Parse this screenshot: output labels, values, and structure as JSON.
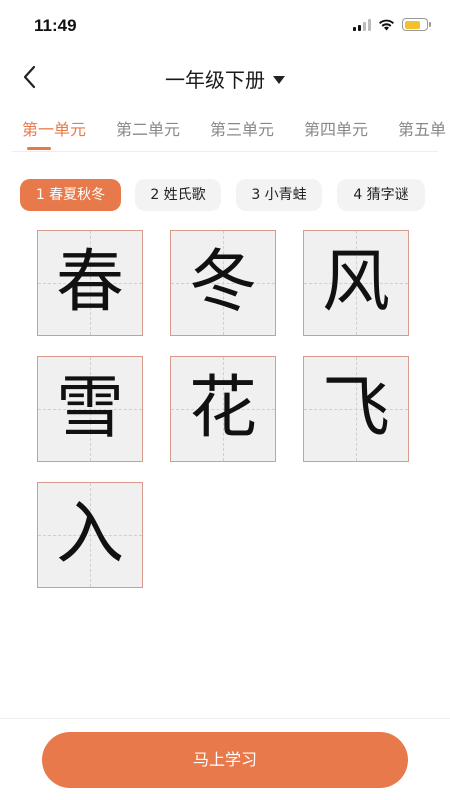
{
  "status_bar": {
    "time": "11:49",
    "battery_level": 0.75,
    "battery_color": "#f2c12e"
  },
  "nav": {
    "title": "一年级下册",
    "back_icon": "chevron-left-icon",
    "dropdown_icon": "caret-down-icon"
  },
  "unit_tabs": [
    {
      "label": "第一单元",
      "active": true
    },
    {
      "label": "第二单元",
      "active": false
    },
    {
      "label": "第三单元",
      "active": false
    },
    {
      "label": "第四单元",
      "active": false
    },
    {
      "label": "第五单",
      "active": false
    }
  ],
  "lessons": [
    {
      "label": "1 春夏秋冬",
      "active": true
    },
    {
      "label": "2 姓氏歌",
      "active": false
    },
    {
      "label": "3 小青蛙",
      "active": false
    },
    {
      "label": "4 猜字谜",
      "active": false
    }
  ],
  "characters": [
    "春",
    "冬",
    "风",
    "雪",
    "花",
    "飞",
    "入"
  ],
  "action_button": "马上学习",
  "colors": {
    "accent": "#e8794a",
    "chip_bg": "#f3f3f3",
    "cell_bg": "#f0f0f0",
    "cell_border": "#d99a8e"
  }
}
